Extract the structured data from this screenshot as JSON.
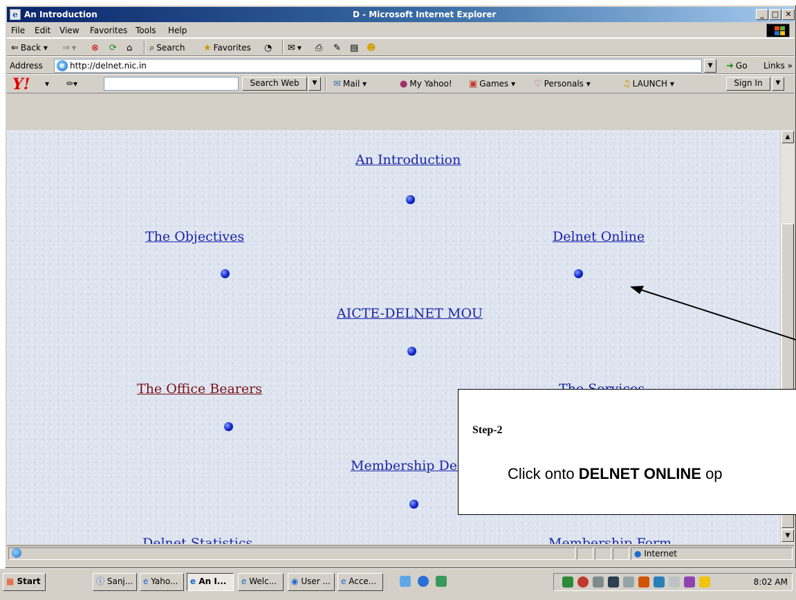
{
  "window": {
    "doc_title": "An Introduction",
    "app_title": "D - Microsoft Internet Explorer",
    "minimize": "_",
    "maximize": "□",
    "close": "✕"
  },
  "menu": [
    "File",
    "Edit",
    "View",
    "Favorites",
    "Tools",
    "Help"
  ],
  "toolbar": {
    "back": "Back",
    "search": "Search",
    "favorites": "Favorites"
  },
  "address": {
    "label": "Address",
    "url": "http://delnet.nic.in",
    "go": "Go",
    "links": "Links »"
  },
  "yahoo": {
    "logo": "Y!",
    "search_value": "",
    "search_button": "Search Web",
    "mail": "Mail",
    "my_yahoo": "My Yahoo!",
    "games": "Games",
    "personals": "Personals",
    "launch": "LAUNCH",
    "sign_in": "Sign In"
  },
  "page": {
    "links": {
      "introduction": "An Introduction",
      "objectives": "The Objectives",
      "delnet_online": "Delnet Online",
      "mou": "AICTE-DELNET MOU",
      "office_bearers": "The Office Bearers",
      "services_partial": "The Services",
      "membership_details": "Membership Details",
      "statistics": "Delnet Statistics",
      "membership_form": "Membership Form"
    }
  },
  "annotation": {
    "step": "Step-2",
    "instruction_prefix": "Click onto ",
    "instruction_bold": "DELNET ONLINE",
    "instruction_suffix": " op"
  },
  "status": {
    "zone": "Internet"
  },
  "taskbar": {
    "start": "Start",
    "tasks": [
      "Sanj...",
      "Yaho...",
      "An I...",
      "Welc...",
      "User ...",
      "Acce..."
    ],
    "clock": "8:02 AM"
  },
  "colors": {
    "link": "#1a23a6",
    "visited_link": "#7a1018",
    "page_background": "#dde4ef",
    "title_bar": "#0a246a"
  }
}
